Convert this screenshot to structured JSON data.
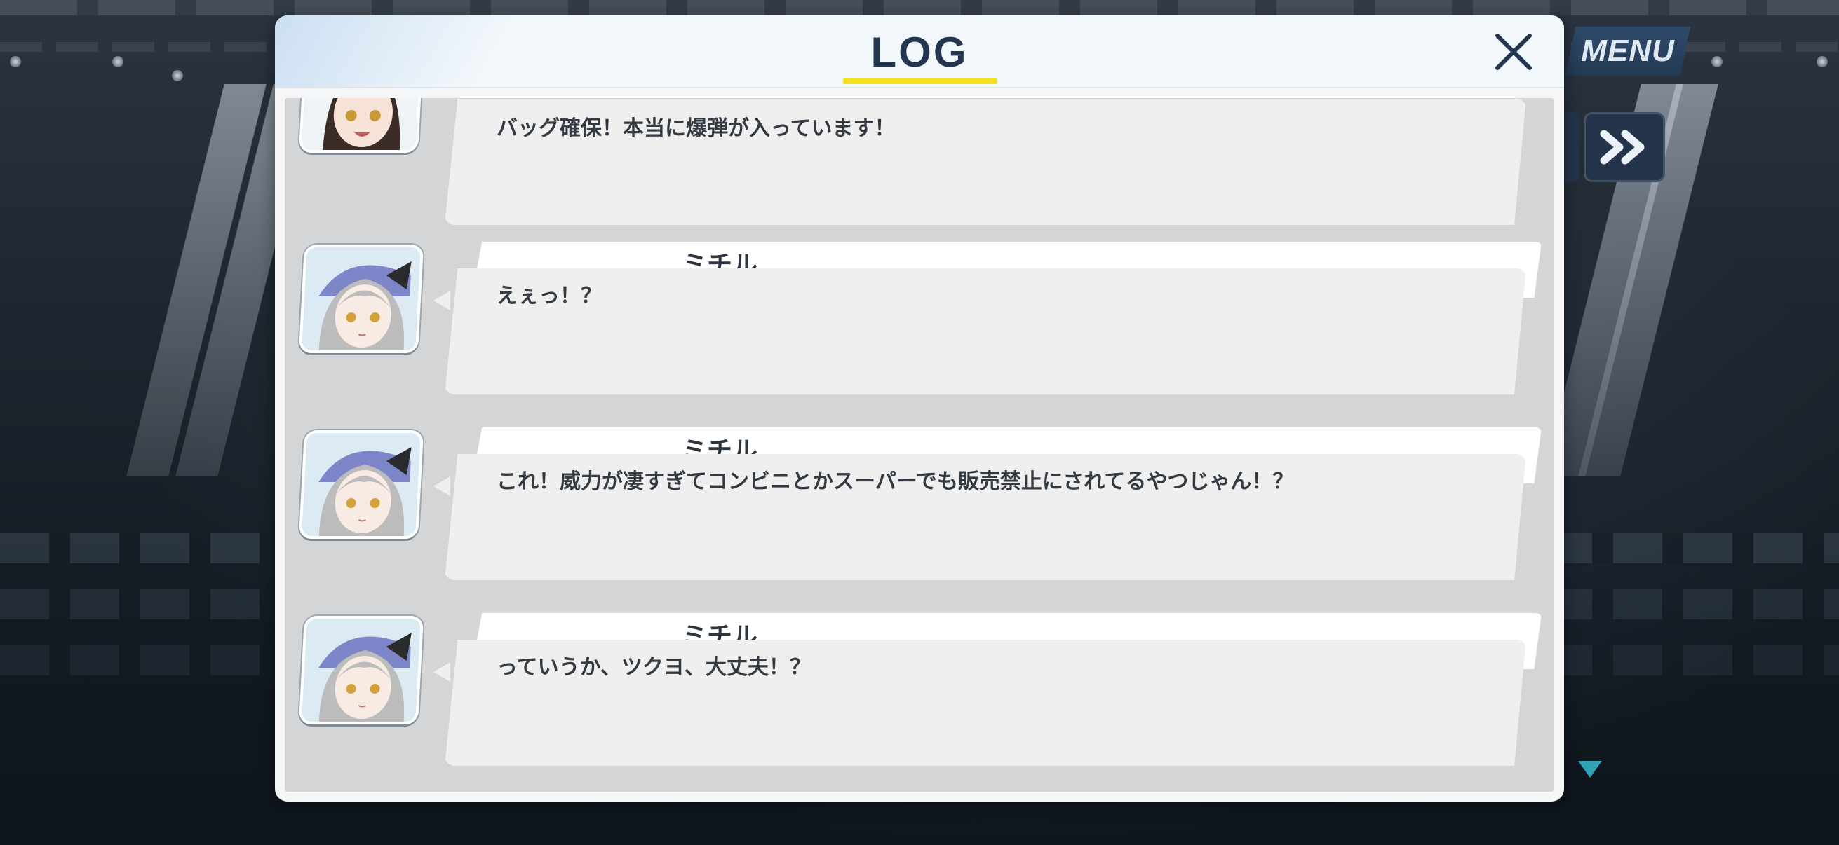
{
  "header": {
    "title": "LOG",
    "close_icon": "close-icon"
  },
  "controls": {
    "menu_label": "MENU",
    "fast_forward_icon": "fast-forward-icon",
    "scroll_down_icon": "triangle-down-icon"
  },
  "colors": {
    "title_text": "#24364f",
    "title_underline": "#f2e21d",
    "menu_bg": "#2f4a6a",
    "bubble_bg": "#efefef",
    "log_bg": "#d3d5d7"
  },
  "log_entries": [
    {
      "speaker": "",
      "avatar": "brown-haired-girl-portrait",
      "text": "バッグ確保！本当に爆弾が入っています！"
    },
    {
      "speaker": "ミチル",
      "avatar": "silver-haired-girl-portrait",
      "text": "えぇっ！？"
    },
    {
      "speaker": "ミチル",
      "avatar": "silver-haired-girl-portrait",
      "text": "これ！威力が凄すぎてコンビニとかスーパーでも販売禁止にされてるやつじゃん！？"
    },
    {
      "speaker": "ミチル",
      "avatar": "silver-haired-girl-portrait",
      "text": "っていうか、ツクヨ、大丈夫！？"
    }
  ]
}
